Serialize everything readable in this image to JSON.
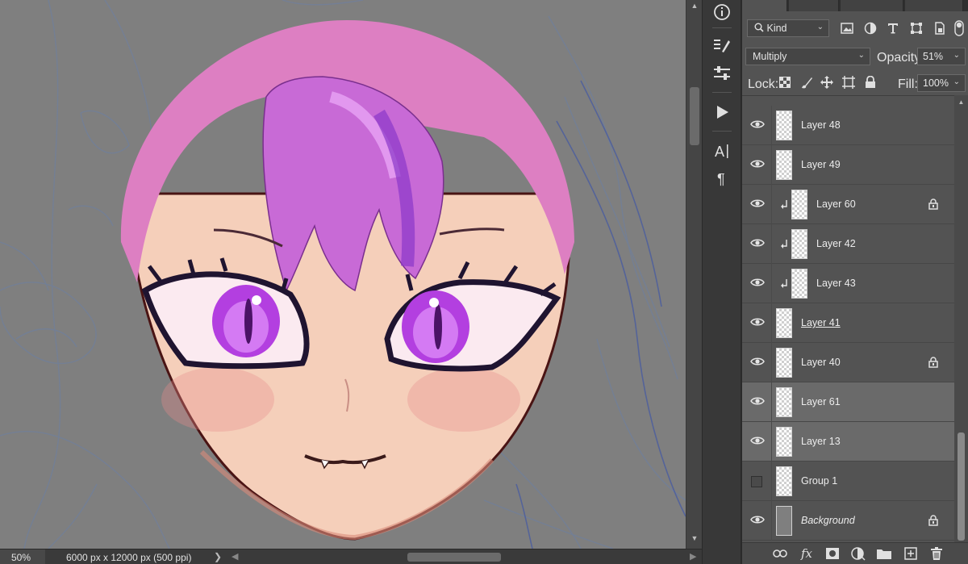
{
  "canvas": {
    "artwork": "anime-face-illustration"
  },
  "statusbar": {
    "zoom": "50%",
    "doc_info": "6000 px x 12000 px (500 ppi)",
    "more_glyph": "❯"
  },
  "tools": [
    {
      "name": "info-panel-icon"
    },
    {
      "name": "brush-settings-icon"
    },
    {
      "name": "adjustments-icon"
    },
    {
      "name": "actions-play-icon"
    },
    {
      "name": "character-panel-icon"
    },
    {
      "name": "paragraph-panel-icon"
    }
  ],
  "layers_panel": {
    "filter": {
      "label": "Kind",
      "icons": [
        "image-filter-icon",
        "adjustment-filter-icon",
        "type-filter-icon",
        "shape-filter-icon",
        "smart-object-filter-icon"
      ]
    },
    "blend_mode": "Multiply",
    "opacity_label": "Opacity:",
    "opacity_value": "51%",
    "lock_label": "Lock:",
    "fill_label": "Fill:",
    "fill_value": "100%",
    "layers": [
      {
        "name": "Layer 48",
        "visible": true,
        "clipped": false,
        "locked": false,
        "selected": false,
        "style": ""
      },
      {
        "name": "Layer 49",
        "visible": true,
        "clipped": false,
        "locked": false,
        "selected": false,
        "style": ""
      },
      {
        "name": "Layer 60",
        "visible": true,
        "clipped": true,
        "locked": true,
        "selected": false,
        "style": ""
      },
      {
        "name": "Layer 42",
        "visible": true,
        "clipped": true,
        "locked": false,
        "selected": false,
        "style": ""
      },
      {
        "name": "Layer 43",
        "visible": true,
        "clipped": true,
        "locked": false,
        "selected": false,
        "style": ""
      },
      {
        "name": "Layer 41",
        "visible": true,
        "clipped": false,
        "locked": false,
        "selected": false,
        "style": "underline"
      },
      {
        "name": "Layer 40",
        "visible": true,
        "clipped": false,
        "locked": true,
        "selected": false,
        "style": ""
      },
      {
        "name": "Layer 61",
        "visible": true,
        "clipped": false,
        "locked": false,
        "selected": true,
        "style": ""
      },
      {
        "name": "Layer 13",
        "visible": true,
        "clipped": false,
        "locked": false,
        "selected": true,
        "style": ""
      },
      {
        "name": "Group 1",
        "visible": false,
        "clipped": false,
        "locked": false,
        "selected": false,
        "style": ""
      },
      {
        "name": "Background",
        "visible": true,
        "clipped": false,
        "locked": true,
        "selected": false,
        "style": "italic"
      }
    ]
  },
  "colors": {
    "canvas_bg": "#7f7f7f",
    "hair": "#dd7fc2",
    "skin": "#f5cfba",
    "eye": "#b33fe0",
    "panel_bg": "#535353",
    "selected_row": "#6a6a6a"
  }
}
